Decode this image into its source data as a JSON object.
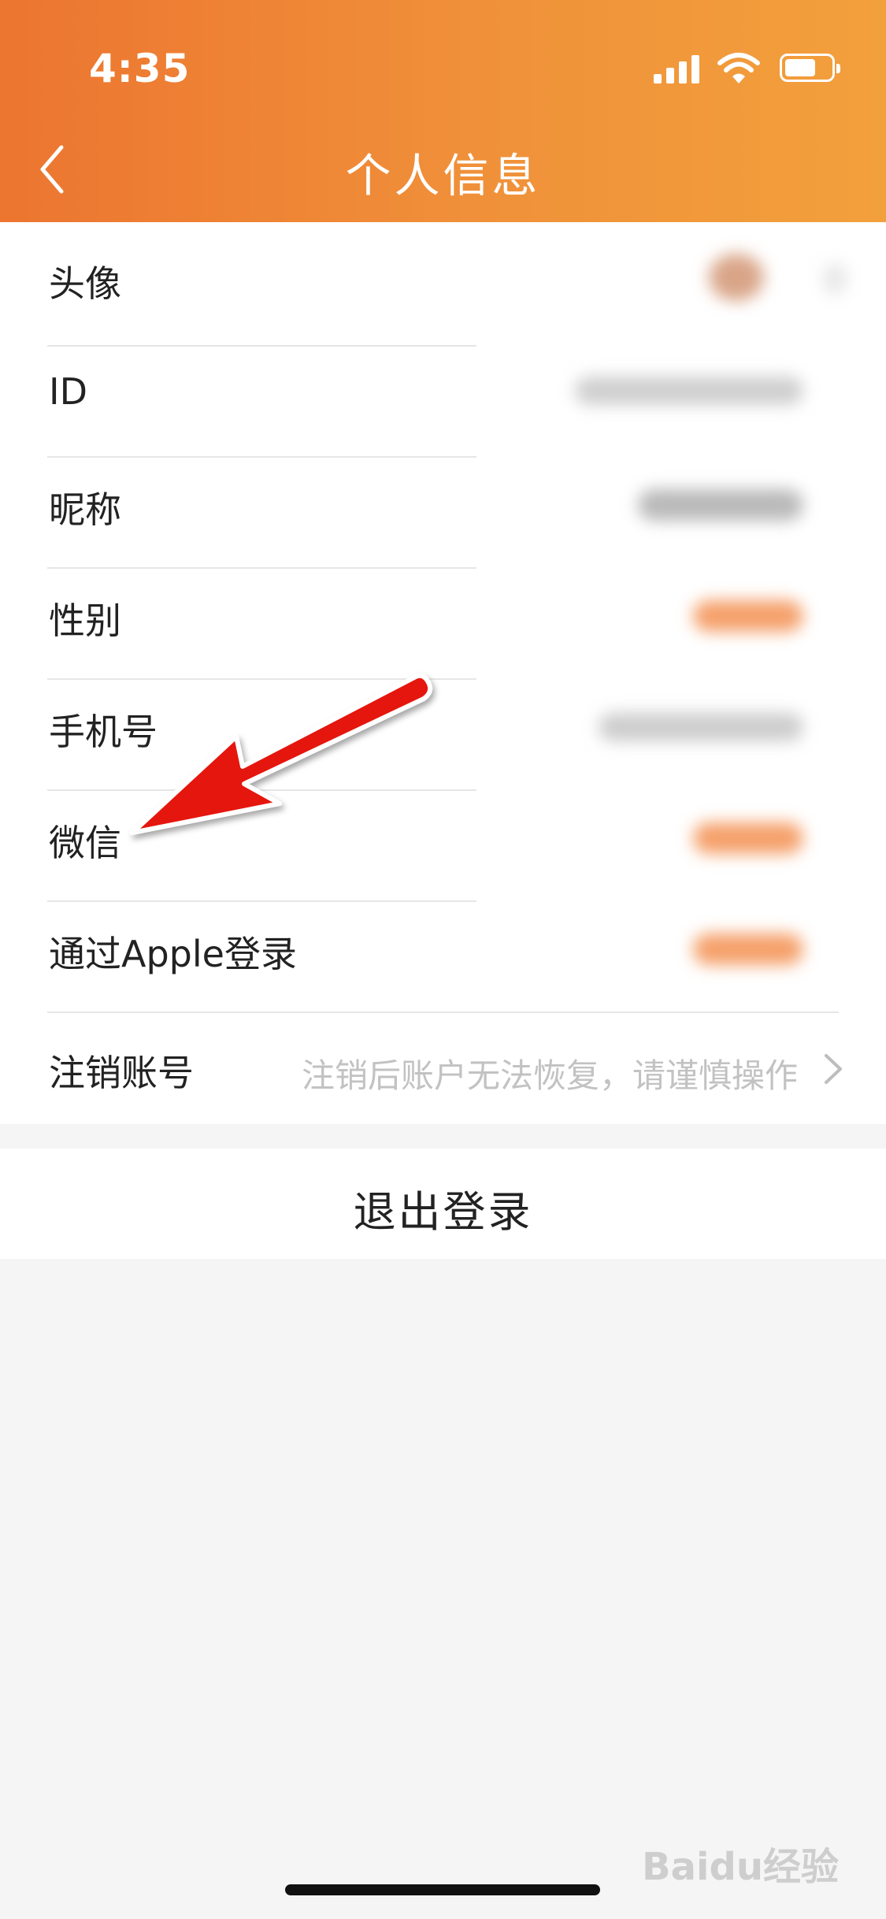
{
  "status_bar": {
    "time": "4:35"
  },
  "nav": {
    "title": "个人信息",
    "back_icon": "chevron-left-icon"
  },
  "rows": [
    {
      "label": "头像"
    },
    {
      "label": "ID"
    },
    {
      "label": "昵称"
    },
    {
      "label": "性别"
    },
    {
      "label": "手机号"
    },
    {
      "label": "微信"
    },
    {
      "label": "通过Apple登录"
    },
    {
      "label": "注销账号",
      "hint": "注销后账户无法恢复，请谨慎操作"
    }
  ],
  "logout": {
    "label": "退出登录"
  },
  "watermark": "Baidu经验",
  "colors": {
    "header_start": "#ec7530",
    "header_end": "#f2a03c",
    "arrow": "#e5140e",
    "blurred_accent": "#f5a06a"
  }
}
